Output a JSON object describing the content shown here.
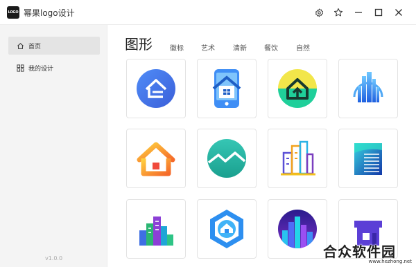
{
  "app": {
    "logo_text": "LOGO",
    "title": "幂果logo设计",
    "version": "v1.0.0"
  },
  "window_controls": {
    "icons": [
      "settings-icon",
      "star-icon",
      "minimize-icon",
      "maximize-icon",
      "close-icon"
    ]
  },
  "sidebar": {
    "items": [
      {
        "label": "首页",
        "icon": "home-icon",
        "active": true
      },
      {
        "label": "我的设计",
        "icon": "grid-icon",
        "active": false
      }
    ]
  },
  "category_tabs": [
    {
      "label": "图形",
      "active": true
    },
    {
      "label": "徽标",
      "active": false
    },
    {
      "label": "艺术",
      "active": false
    },
    {
      "label": "清新",
      "active": false
    },
    {
      "label": "餐饮",
      "active": false
    },
    {
      "label": "自然",
      "active": false
    }
  ],
  "accent_color": "#f15a24",
  "templates": [
    {
      "name": "blue-circle-house-logo"
    },
    {
      "name": "phone-house-logo"
    },
    {
      "name": "yellow-green-house-logo"
    },
    {
      "name": "blue-skyscraper-logo"
    },
    {
      "name": "orange-house-logo"
    },
    {
      "name": "teal-roof-circle-logo"
    },
    {
      "name": "colorful-buildings-logo"
    },
    {
      "name": "blue-tower-logo"
    },
    {
      "name": "city-blocks-logo"
    },
    {
      "name": "hexagon-house-logo"
    },
    {
      "name": "night-city-circle-logo"
    },
    {
      "name": "purple-house-logo"
    }
  ],
  "watermark": {
    "text": "合众软件园",
    "url": "www.hezhong.net"
  }
}
